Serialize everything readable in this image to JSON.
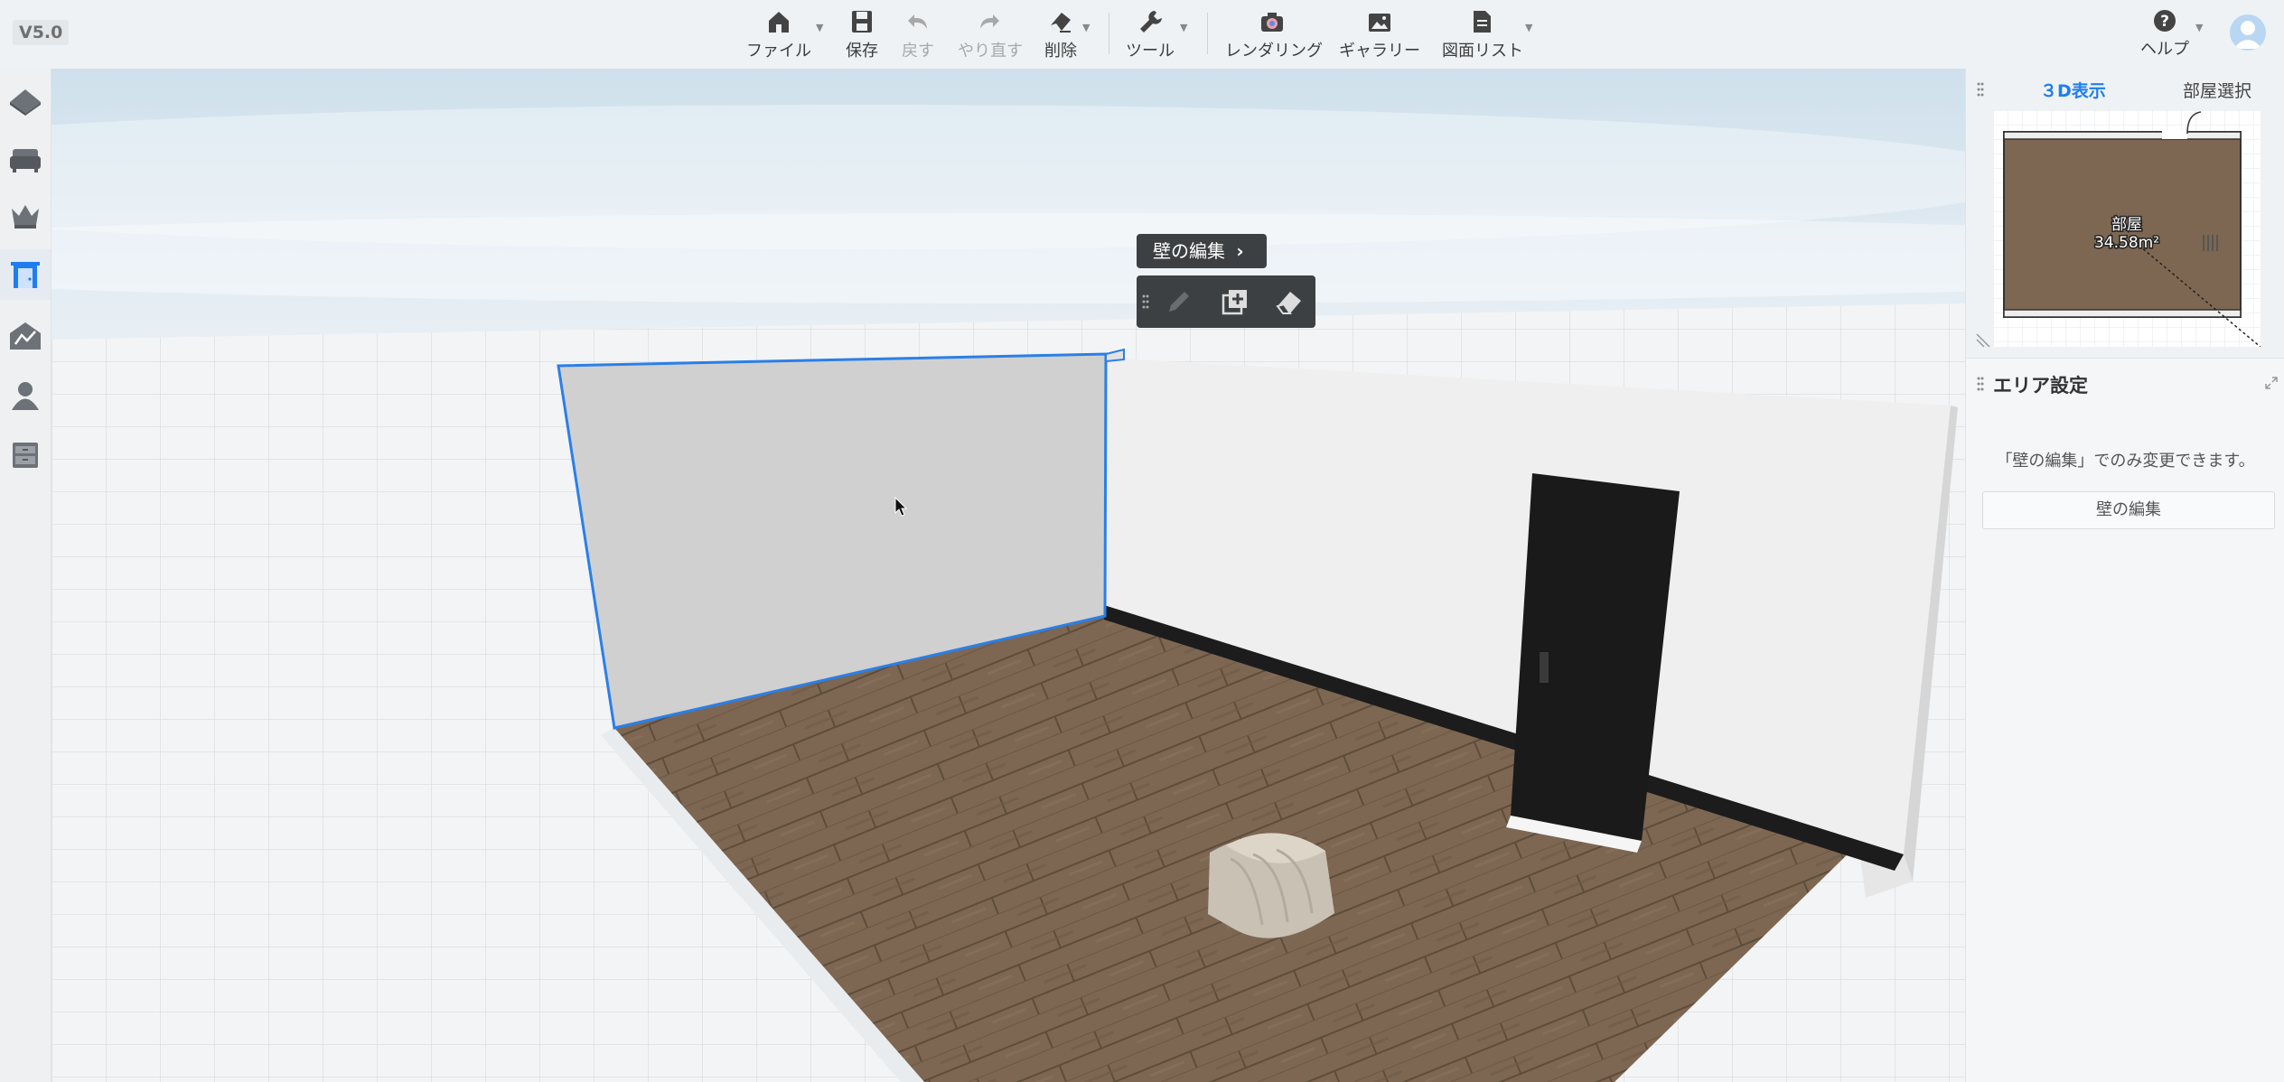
{
  "app": {
    "version": "V5.0"
  },
  "toolbar": {
    "file": "ファイル",
    "save": "保存",
    "undo": "戻す",
    "redo": "やり直す",
    "delete": "削除",
    "tools": "ツール",
    "rendering": "レンダリング",
    "gallery": "ギャラリー",
    "drawing_list": "図面リスト",
    "help": "ヘルプ"
  },
  "sidebar": {
    "items": [
      {
        "name": "floor-icon"
      },
      {
        "name": "furniture-icon"
      },
      {
        "name": "crown-icon"
      },
      {
        "name": "door-icon",
        "active": true
      },
      {
        "name": "terrain-icon"
      },
      {
        "name": "person-icon"
      },
      {
        "name": "cabinet-icon"
      }
    ]
  },
  "wall_edit": {
    "label": "壁の編集",
    "tools": [
      "pencil-icon",
      "add-copy-icon",
      "eraser-icon"
    ]
  },
  "right_panel": {
    "tabs": {
      "view3d": "３D表示",
      "room_select": "部屋選択"
    },
    "minimap": {
      "room_name": "部屋",
      "room_area": "34.58m²"
    },
    "area_settings": {
      "title": "エリア設定",
      "message": "「壁の編集」でのみ変更できます。",
      "edit_button": "壁の編集"
    }
  },
  "colors": {
    "accent": "#1e7ef0",
    "floor": "#7a6550",
    "door": "#1a1a1a",
    "selection": "#2a7fe8"
  }
}
